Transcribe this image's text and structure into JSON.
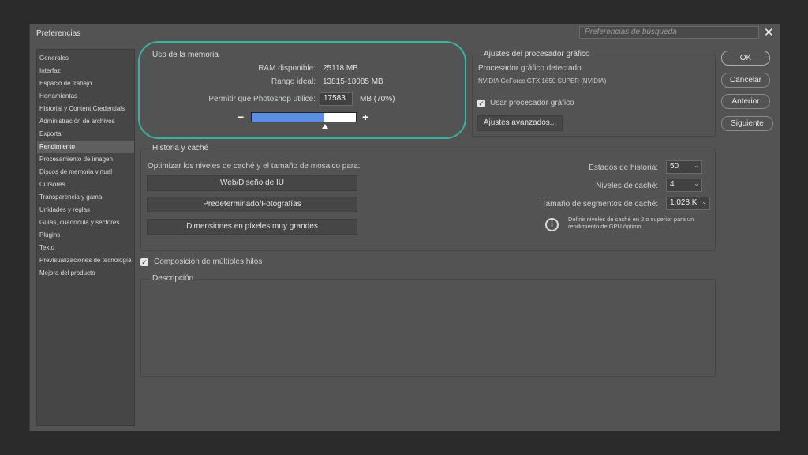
{
  "title": "Preferencias",
  "search_placeholder": "Preferencias de búsqueda",
  "close_glyph": "✕",
  "sidebar": {
    "items": [
      {
        "label": "Generales"
      },
      {
        "label": "Interfaz"
      },
      {
        "label": "Espacio de trabajo"
      },
      {
        "label": "Herramientas"
      },
      {
        "label": "Historial y Content Credentials"
      },
      {
        "label": "Administración de archivos"
      },
      {
        "label": "Exportar"
      },
      {
        "label": "Rendimiento",
        "selected": true
      },
      {
        "label": "Procesamiento de imagen"
      },
      {
        "label": "Discos de memoria virtual"
      },
      {
        "label": "Cursores"
      },
      {
        "label": "Transparencia y gama"
      },
      {
        "label": "Unidades y reglas"
      },
      {
        "label": "Guías, cuadrícula y sectores"
      },
      {
        "label": "Plugins"
      },
      {
        "label": "Texto"
      },
      {
        "label": "Previsualizaciones de tecnología"
      },
      {
        "label": "Mejora del producto"
      }
    ]
  },
  "memory": {
    "title": "Uso de la memoria",
    "ram_label": "RAM disponible:",
    "ram_value": "25118 MB",
    "range_label": "Rango ideal:",
    "range_value": "13815-18085 MB",
    "allow_label": "Permitir que Photoshop utilice:",
    "allow_value": "17583",
    "allow_suffix": "MB (70%)",
    "minus": "−",
    "plus": "+",
    "slider_percent": 70
  },
  "gpu": {
    "title": "Ajustes del procesador gráfico",
    "detected_label": "Procesador gráfico detectado",
    "detected_value": "NVIDIA GeForce GTX 1650 SUPER (NVIDIA)",
    "use_gpu_label": "Usar procesador gráfico",
    "use_gpu_checked": true,
    "advanced_button": "Ajustes avanzados..."
  },
  "history": {
    "title": "Historia y caché",
    "optimize_label": "Optimizar los niveles de caché y el tamaño de mosaico para:",
    "buttons": [
      "Web/Diseño de IU",
      "Predeterminado/Fotografías",
      "Dimensiones en píxeles muy grandes"
    ],
    "states_label": "Estados de historia:",
    "states_value": "50",
    "levels_label": "Niveles de caché:",
    "levels_value": "4",
    "tile_label": "Tamaño de segmentos de caché:",
    "tile_value": "1.028 K",
    "info_glyph": "i",
    "note": "Definir niveles de caché en 2 o superior para un rendimiento de GPU óptimo."
  },
  "multithread": {
    "label": "Composición de múltiples hilos",
    "checked": true
  },
  "description": {
    "title": "Descripción"
  },
  "buttons": {
    "ok": "OK",
    "cancel": "Cancelar",
    "previous": "Anterior",
    "next": "Siguiente"
  },
  "colors": {
    "highlight": "#36b3a1",
    "slider_fill": "#5b8fe3",
    "dialog_bg": "#535353"
  }
}
